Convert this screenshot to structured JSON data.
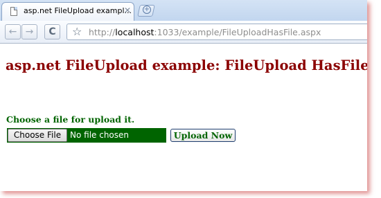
{
  "tab": {
    "title": "asp.net FileUpload exampl...",
    "close_glyph": "✕"
  },
  "newtab": {
    "glyph": "+"
  },
  "toolbar": {
    "back_glyph": "←",
    "forward_glyph": "→",
    "reload_glyph": "C",
    "star_glyph": "☆",
    "url_prefix": "http://",
    "url_host": "localhost",
    "url_rest": ":1033/example/FileUploadHasFile.aspx"
  },
  "page": {
    "title": "asp.net FileUpload example: FileUpload HasFile",
    "prompt": "Choose a file for upload it.",
    "choose_file_label": "Choose File",
    "no_file_text": "No file chosen",
    "upload_button_label": "Upload Now"
  },
  "colors": {
    "title": "#8b0000",
    "green": "#006400"
  }
}
